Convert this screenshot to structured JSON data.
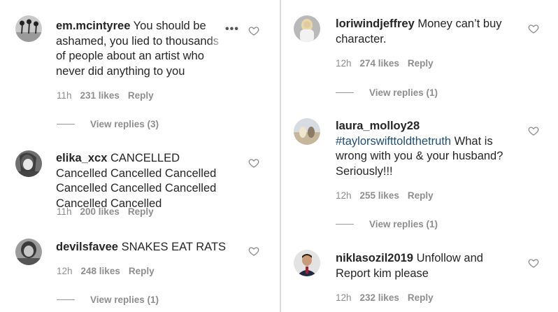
{
  "left": {
    "c1": {
      "user": "em.mcintyree",
      "text": " You should be ashamed, you lied to thousands of people about an artist who never did anything to you",
      "time": "11h",
      "likes": "231 likes",
      "reply": "Reply",
      "view": "View replies (3)",
      "more": "•••"
    },
    "c2": {
      "user": "elika_xcx",
      "text": " CANCELLED Cancelled Cancelled Cancelled Cancelled Cancelled Cancelled Cancelled Cancelled",
      "time": "11h",
      "likes": "200 likes",
      "reply": "Reply"
    },
    "c3": {
      "user": "devilsfavee",
      "text": " SNAKES EAT RATS",
      "time": "12h",
      "likes": "248 likes",
      "reply": "Reply",
      "view": "View replies (1)"
    }
  },
  "right": {
    "c1": {
      "user": "loriwindjeffrey",
      "text": " Money can’t buy character.",
      "time": "12h",
      "likes": "274 likes",
      "reply": "Reply",
      "view": "View replies (1)"
    },
    "c2": {
      "user": "laura_molloy28",
      "hashtag": "#taylorswifttoldthetruth",
      "text": " What is wrong with you & your husband? Seriously!!!",
      "time": "12h",
      "likes": "255 likes",
      "reply": "Reply",
      "view": "View replies (1)"
    },
    "c3": {
      "user": "niklasozil2019",
      "text": " Unfollow and Report kim please",
      "time": "12h",
      "likes": "232 likes",
      "reply": "Reply"
    }
  },
  "icons": {
    "heart": "heart-outline-icon",
    "more": "more-options-icon"
  },
  "colors": {
    "text": "#262626",
    "meta": "#8e8e8e",
    "hashtag": "#1f4e79",
    "divider": "#dadada"
  }
}
